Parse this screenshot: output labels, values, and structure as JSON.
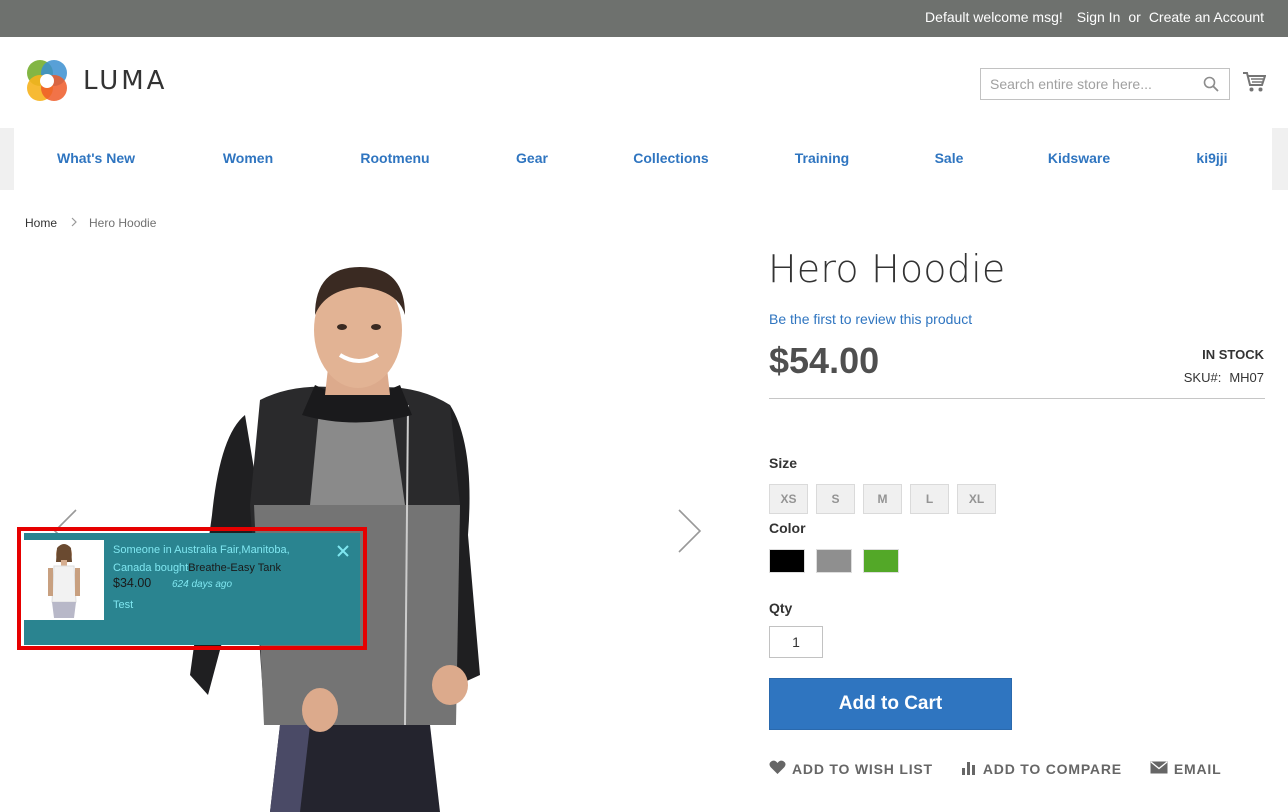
{
  "topbar": {
    "welcome": "Default welcome msg!",
    "sign_in": "Sign In",
    "or": "or",
    "create_account": "Create an Account"
  },
  "header": {
    "logo_text": "LUMA",
    "search_placeholder": "Search entire store here...",
    "icons": [
      "search-icon",
      "cart-icon"
    ]
  },
  "nav": {
    "items": [
      {
        "label": "What's New"
      },
      {
        "label": "Women"
      },
      {
        "label": "Rootmenu"
      },
      {
        "label": "Gear"
      },
      {
        "label": "Collections"
      },
      {
        "label": "Training"
      },
      {
        "label": "Sale"
      },
      {
        "label": "Kidsware"
      },
      {
        "label": "ki9jji"
      }
    ]
  },
  "breadcrumb": {
    "home": "Home",
    "current": "Hero Hoodie"
  },
  "product": {
    "title": "Hero Hoodie",
    "review_link": "Be the first to review this product",
    "price": "$54.00",
    "stock": "IN STOCK",
    "sku_label": "SKU#:",
    "sku": "MH07",
    "size_label": "Size",
    "sizes": [
      "XS",
      "S",
      "M",
      "L",
      "XL"
    ],
    "color_label": "Color",
    "colors": [
      "#000000",
      "#8f8f8f",
      "#53a828"
    ],
    "qty_label": "Qty",
    "qty": "1",
    "add_to_cart": "Add to Cart",
    "actions": {
      "wishlist": "ADD TO WISH LIST",
      "compare": "ADD TO COMPARE",
      "email": "EMAIL"
    }
  },
  "notification": {
    "text_line": "Someone in Australia Fair,Manitoba, Canada bought",
    "product": "Breathe-Easy Tank",
    "price": "$34.00",
    "time_ago": "624 days ago",
    "link": "Test"
  },
  "colors": {
    "topbar_bg": "#6e716e",
    "link_blue": "#2f75c0",
    "popup_bg": "#2a8490",
    "popup_border": "#e60000"
  }
}
